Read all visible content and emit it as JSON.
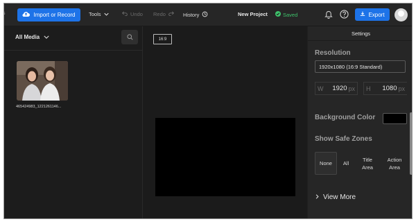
{
  "topbar": {
    "edge_text": "s",
    "import_label": "Import or Record",
    "tools_label": "Tools",
    "undo_label": "Undo",
    "redo_label": "Redo",
    "history_label": "History",
    "project_name": "New Project",
    "saved_label": "Saved",
    "export_label": "Export"
  },
  "left_panel": {
    "media_dropdown": "All Media",
    "media_items": [
      {
        "name": "465424983_1221261146..."
      }
    ]
  },
  "center": {
    "aspect_ratio": "16:9"
  },
  "settings": {
    "tab_label": "Settings",
    "resolution_title": "Resolution",
    "resolution_value": "1920x1080 (16:9 Standard)",
    "width_label": "W",
    "width_value": "1920",
    "height_label": "H",
    "height_value": "1080",
    "unit": "px",
    "background_title": "Background Color",
    "background_color": "#000000",
    "safe_zones_title": "Show Safe Zones",
    "safe_zones": [
      {
        "label": "None",
        "active": true
      },
      {
        "label": "All",
        "active": false
      },
      {
        "label": "Title\nArea",
        "active": false
      },
      {
        "label": "Action\nArea",
        "active": false
      }
    ],
    "view_more_label": "View More"
  },
  "colors": {
    "accent": "#1d73e8",
    "saved": "#3ec26b"
  }
}
